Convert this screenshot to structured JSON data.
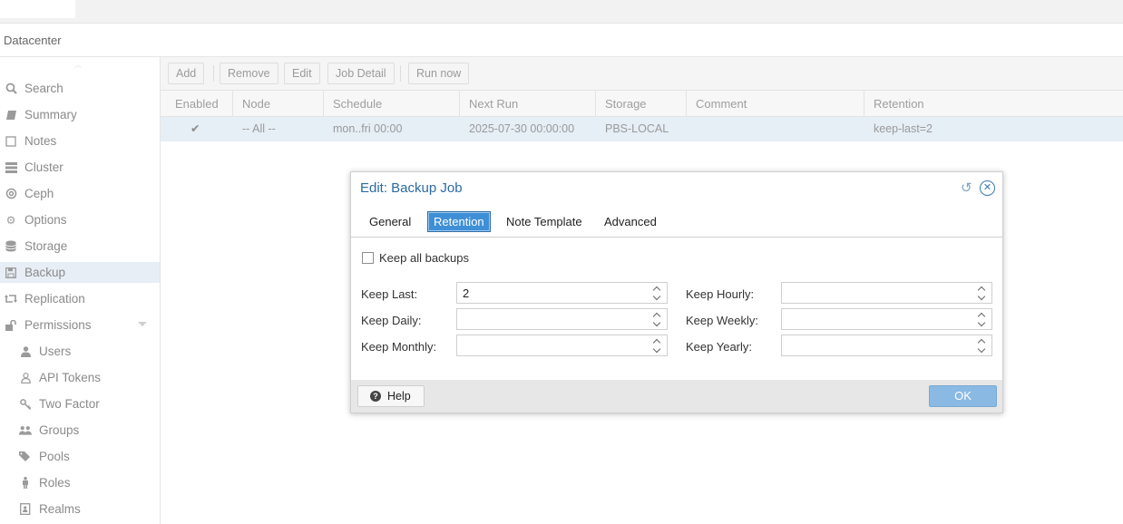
{
  "breadcrumb": {
    "datacenter": "Datacenter"
  },
  "sidebar": {
    "items": [
      {
        "label": "Search",
        "icon": "search-icon"
      },
      {
        "label": "Summary",
        "icon": "book-icon"
      },
      {
        "label": "Notes",
        "icon": "note-icon"
      },
      {
        "label": "Cluster",
        "icon": "server-icon"
      },
      {
        "label": "Ceph",
        "icon": "ceph-icon"
      },
      {
        "label": "Options",
        "icon": "gear-icon"
      },
      {
        "label": "Storage",
        "icon": "database-icon"
      },
      {
        "label": "Backup",
        "icon": "floppy-icon"
      },
      {
        "label": "Replication",
        "icon": "retweet-icon"
      },
      {
        "label": "Permissions",
        "icon": "unlock-icon"
      },
      {
        "label": "Users",
        "icon": "user-icon"
      },
      {
        "label": "API Tokens",
        "icon": "user-outline-icon"
      },
      {
        "label": "Two Factor",
        "icon": "key-icon"
      },
      {
        "label": "Groups",
        "icon": "users-icon"
      },
      {
        "label": "Pools",
        "icon": "tags-icon"
      },
      {
        "label": "Roles",
        "icon": "male-icon"
      },
      {
        "label": "Realms",
        "icon": "address-book-icon"
      }
    ],
    "active": "Backup"
  },
  "toolbar": {
    "add": "Add",
    "remove": "Remove",
    "edit": "Edit",
    "job_detail": "Job Detail",
    "run_now": "Run now"
  },
  "grid": {
    "columns": [
      "Enabled",
      "Node",
      "Schedule",
      "Next Run",
      "Storage",
      "Comment",
      "Retention"
    ],
    "rows": [
      {
        "enabled": "✔",
        "node": "-- All --",
        "schedule": "mon..fri 00:00",
        "next_run": "2025-07-30 00:00:00",
        "storage": "PBS-LOCAL",
        "comment": "",
        "retention": "keep-last=2"
      }
    ]
  },
  "dialog": {
    "title": "Edit: Backup Job",
    "tabs": [
      "General",
      "Retention",
      "Note Template",
      "Advanced"
    ],
    "active_tab": "Retention",
    "keep_all_label": "Keep all backups",
    "keep_all_checked": false,
    "fields": {
      "keep_last": {
        "label": "Keep Last:",
        "value": "2"
      },
      "keep_daily": {
        "label": "Keep Daily:",
        "value": ""
      },
      "keep_monthly": {
        "label": "Keep Monthly:",
        "value": ""
      },
      "keep_hourly": {
        "label": "Keep Hourly:",
        "value": ""
      },
      "keep_weekly": {
        "label": "Keep Weekly:",
        "value": ""
      },
      "keep_yearly": {
        "label": "Keep Yearly:",
        "value": ""
      }
    },
    "help_label": "Help",
    "ok_label": "OK"
  },
  "colors": {
    "accent": "#3f8fd6",
    "title_blue": "#2c6aa3",
    "ok_disabled": "#8ab9e3",
    "row_selected": "#e6eef6"
  }
}
